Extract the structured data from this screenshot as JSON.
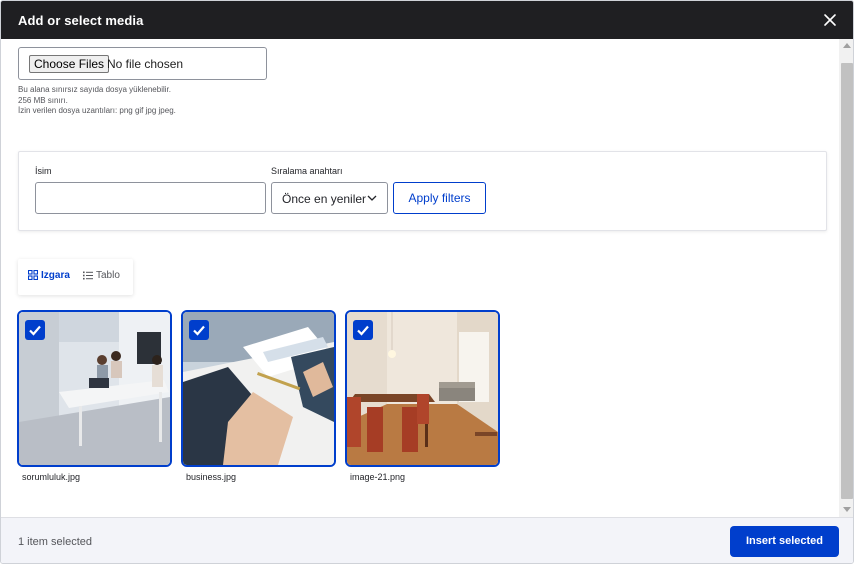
{
  "dialog": {
    "title": "Add or select media",
    "close_icon": "close-icon"
  },
  "upload": {
    "button_label": "Choose Files",
    "status": "No file chosen",
    "help_lines": [
      "Bu alana sınırsız sayıda dosya yüklenebilir.",
      "256 MB sınırı.",
      "İzin verilen dosya uzantıları: png gif jpg jpeg."
    ]
  },
  "filters": {
    "name_label": "İsim",
    "name_value": "",
    "sort_label": "Sıralama anahtarı",
    "sort_value": "Önce en yeniler",
    "apply_label": "Apply filters"
  },
  "view_toggle": {
    "grid_label": "Izgara",
    "table_label": "Tablo",
    "active": "grid"
  },
  "media": [
    {
      "filename": "sorumluluk.jpg",
      "checked": true,
      "image": "office-meeting-photo"
    },
    {
      "filename": "business.jpg",
      "checked": true,
      "image": "business-handshake-photo"
    },
    {
      "filename": "image-21.png",
      "checked": true,
      "image": "dining-room-photo"
    }
  ],
  "footer": {
    "selected_count": "1 item selected",
    "insert_label": "Insert selected"
  },
  "colors": {
    "accent": "#003ecc",
    "titlebar": "#1f1f22",
    "footer_bg": "#f3f4f9"
  }
}
